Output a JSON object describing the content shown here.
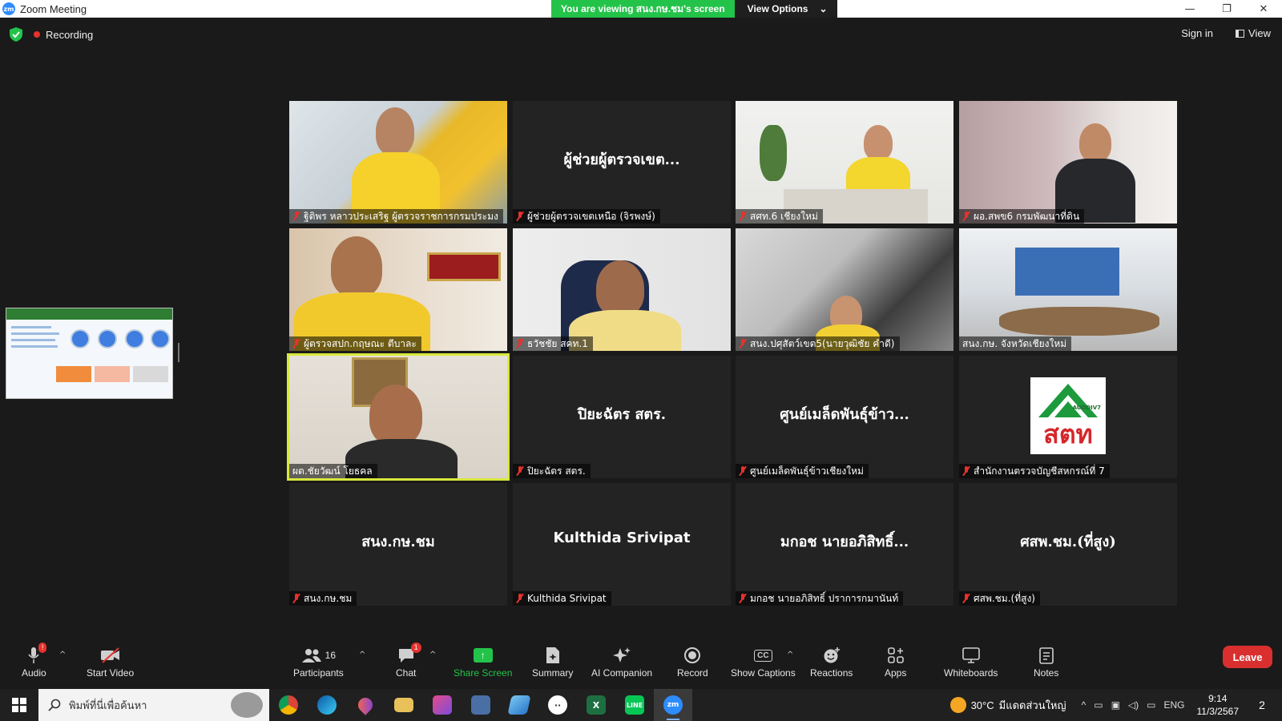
{
  "window": {
    "title": "Zoom Meeting",
    "logo": "zm"
  },
  "banner": {
    "viewing": "You are viewing สนง.กษ.ชม's screen",
    "view_options": "View Options",
    "chevron": "⌄"
  },
  "window_controls": {
    "minimize": "—",
    "restore": "❐",
    "close": "✕"
  },
  "topbar": {
    "recording": "Recording",
    "sign_in": "Sign in",
    "view": "View"
  },
  "tiles": [
    {
      "bigname": "",
      "label": "ฐิติพร หลาวประเสริฐ ผู้ตรวจราชการกรมประมง",
      "video": true
    },
    {
      "bigname": "ผู้ช่วยผู้ตรวจเขต...",
      "label": "ผู้ช่วยผู้ตรวจเขตเหนือ (จิรพงษ์)",
      "video": false
    },
    {
      "bigname": "",
      "label": "สศท.6 เชียงใหม่",
      "video": true
    },
    {
      "bigname": "",
      "label": "ผอ.สพข6 กรมพัฒนาที่ดิน",
      "video": true
    },
    {
      "bigname": "",
      "label": "ผู้ตรวจสปก.กฤษณะ ตีบาละ",
      "video": true
    },
    {
      "bigname": "",
      "label": "ธวัชชัย สคท.1",
      "video": true
    },
    {
      "bigname": "",
      "label": "สนง.ปศุสัตว์เขต5(นายวุฒิชัย คำดี)",
      "video": true
    },
    {
      "bigname": "",
      "label": "สนง.กษ. จังหวัดเชียงใหม่",
      "video": true
    },
    {
      "bigname": "",
      "label": "ผต.ชัยวัฒน์ โยธคล",
      "video": true,
      "active": true
    },
    {
      "bigname": "ปิยะฉัตร สตร.",
      "label": "ปิยะฉัตร สตร.",
      "video": false
    },
    {
      "bigname": "ศูนย์เมล็ดพันธุ์ข้าว...",
      "label": "ศูนย์เมล็ดพันธุ์ข้าวเชียงใหม่",
      "video": false
    },
    {
      "bigname": "",
      "label": "สำนักงานตรวจบัญชีสหกรณ์ที่ 7",
      "video": false,
      "logo": true
    },
    {
      "bigname": "สนง.กษ.ชม",
      "label": "สนง.กษ.ชม",
      "video": false
    },
    {
      "bigname": "Kulthida Srivipat",
      "label": "Kulthida Srivipat",
      "video": false
    },
    {
      "bigname": "มกอช นายอภิสิทธิ์...",
      "label": "มกอช นายอภิสิทธิ์ ปราการกมานันท์",
      "video": false
    },
    {
      "bigname": "ศสพ.ชม.(ที่สูง)",
      "label": "ศสพ.ชม.(ที่สูง)",
      "video": false
    }
  ],
  "audit_logo": {
    "text": "สตท",
    "sub": "AUDDIV7"
  },
  "toolbar": {
    "audio": "Audio",
    "audio_badge": "!",
    "start_video": "Start Video",
    "participants": "Participants",
    "participants_count": "16",
    "chat": "Chat",
    "chat_badge": "1",
    "share_screen": "Share Screen",
    "summary": "Summary",
    "ai_companion": "AI Companion",
    "record": "Record",
    "captions": "Show Captions",
    "captions_icon": "CC",
    "reactions": "Reactions",
    "apps": "Apps",
    "whiteboards": "Whiteboards",
    "notes": "Notes",
    "leave": "Leave"
  },
  "taskbar": {
    "search_placeholder": "พิมพ์ที่นี่เพื่อค้นหา",
    "weather_temp": "30°C",
    "weather_desc": "มีแดดส่วนใหญ่",
    "lang": "ENG",
    "time": "9:14",
    "date": "11/3/2567",
    "notif_count": "2"
  },
  "colors": {
    "share_green": "#23c34a",
    "leave_red": "#d9302f",
    "active_border": "#d7e83a"
  }
}
